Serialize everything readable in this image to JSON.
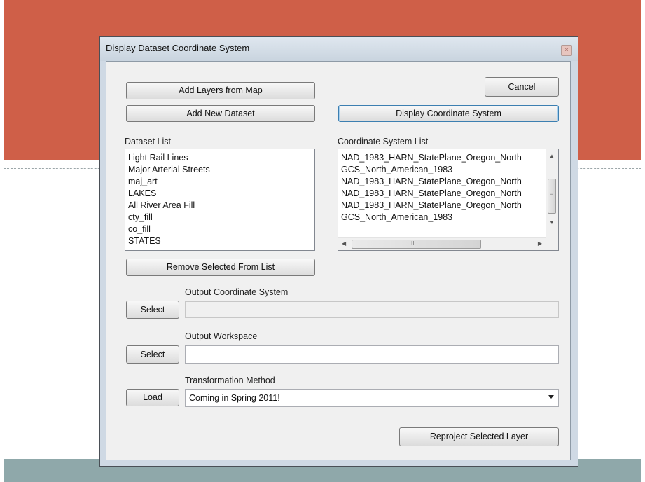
{
  "window": {
    "title": "Display Dataset Coordinate System",
    "close_glyph": "×"
  },
  "buttons": {
    "add_layers": "Add Layers from Map",
    "add_dataset": "Add New Dataset",
    "cancel": "Cancel",
    "display_cs": "Display Coordinate System",
    "remove_selected": "Remove Selected From List",
    "select_cs": "Select",
    "select_workspace": "Select",
    "load": "Load",
    "reproject": "Reproject Selected Layer"
  },
  "labels": {
    "dataset_list": "Dataset List",
    "cs_list": "Coordinate System List",
    "output_cs": "Output Coordinate System",
    "output_workspace": "Output Workspace",
    "transformation": "Transformation Method"
  },
  "dataset_list": [
    "Light Rail Lines",
    "Major Arterial Streets",
    "maj_art",
    "LAKES",
    "All River Area Fill",
    "cty_fill",
    "co_fill",
    "STATES"
  ],
  "cs_list": [
    "NAD_1983_HARN_StatePlane_Oregon_North",
    "GCS_North_American_1983",
    "NAD_1983_HARN_StatePlane_Oregon_North",
    "NAD_1983_HARN_StatePlane_Oregon_North",
    "NAD_1983_HARN_StatePlane_Oregon_North",
    "GCS_North_American_1983"
  ],
  "inputs": {
    "output_cs_value": "",
    "output_workspace_value": "",
    "transformation_value": "Coming in Spring 2011!"
  },
  "scroll_glyphs": {
    "up": "▲",
    "down": "▼",
    "left": "◀",
    "right": "▶",
    "grip_v": "≡",
    "grip_h": "III"
  },
  "colors": {
    "slide_top": "#cf5f48",
    "slide_bottom": "#8fa8aa",
    "window_frame": "#cfd9e4",
    "focus_border": "#3c7fb1"
  }
}
